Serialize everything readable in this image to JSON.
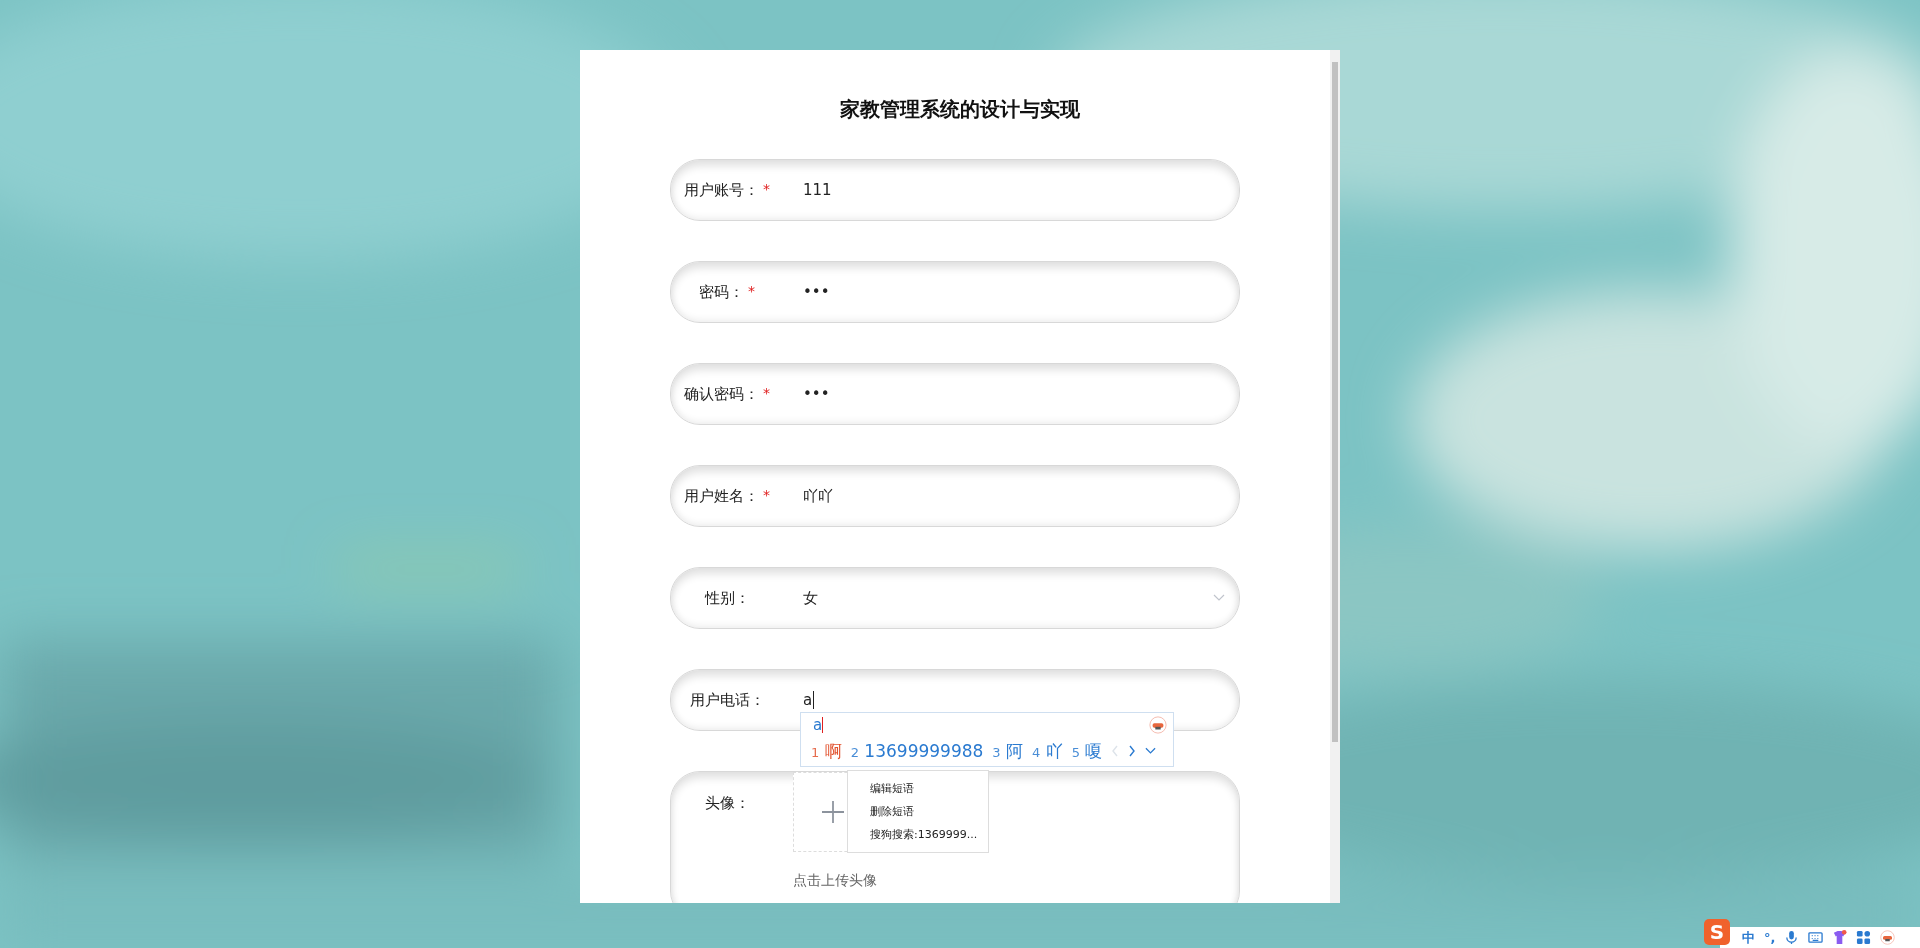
{
  "title": "家教管理系统的设计与实现",
  "fields": [
    {
      "kind": "text",
      "label": "用户账号：",
      "required_mark": "*",
      "value": "111"
    },
    {
      "kind": "text",
      "label": "密码：",
      "required_mark": "*",
      "value": "•••"
    },
    {
      "kind": "text",
      "label": "确认密码：",
      "required_mark": "*",
      "value": "•••"
    },
    {
      "kind": "text",
      "label": "用户姓名：",
      "required_mark": "*",
      "value": "吖吖"
    },
    {
      "kind": "select",
      "label": "性别：",
      "value": "女"
    },
    {
      "kind": "text",
      "label": "用户电话：",
      "value": "a",
      "focused": true
    },
    {
      "kind": "upload",
      "label": "头像：",
      "hint": "点击上传头像"
    }
  ],
  "ime": {
    "composition": "a",
    "candidates": [
      {
        "index": "1",
        "text": "啊",
        "selected": true
      },
      {
        "index": "2",
        "text": "13699999988",
        "selected": false
      },
      {
        "index": "3",
        "text": "阿",
        "selected": false
      },
      {
        "index": "4",
        "text": "吖",
        "selected": false
      },
      {
        "index": "5",
        "text": "嗄",
        "selected": false
      }
    ]
  },
  "context_menu": [
    "编辑短语",
    "删除短语",
    "搜狗搜索:1369999..."
  ],
  "ime_toolbar": {
    "logo": "S",
    "mode": "中",
    "punctuation": "°,"
  }
}
